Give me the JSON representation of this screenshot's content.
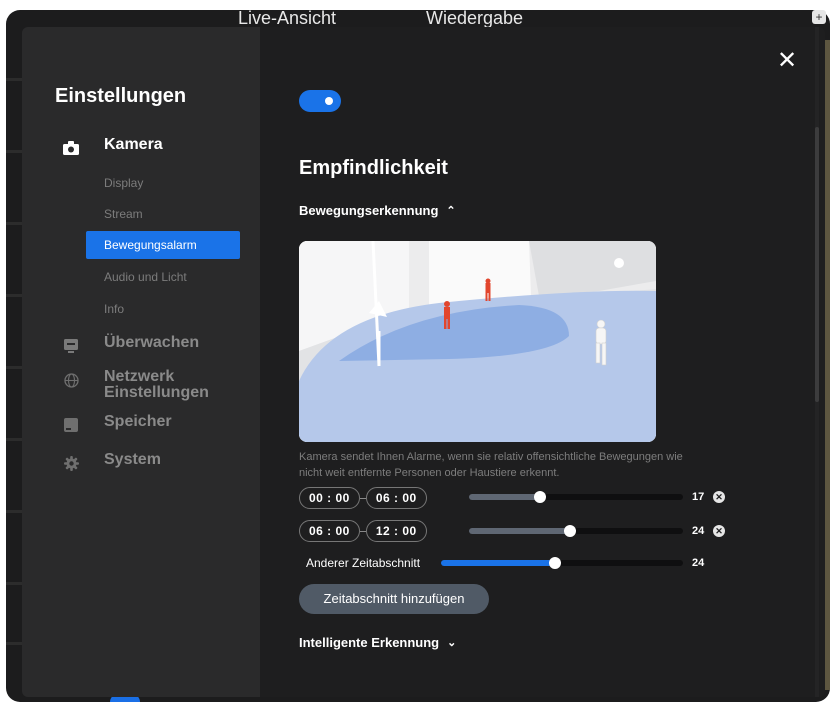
{
  "top_tabs": [
    "Live-Ansicht",
    "Wiedergabe"
  ],
  "sidebar": {
    "title": "Einstellungen",
    "items": [
      {
        "label": "Kamera",
        "icon": "camera-icon",
        "active": true
      },
      {
        "label": "Überwachen",
        "icon": "monitor-icon"
      },
      {
        "label": "Netzwerk Einstellungen",
        "icon": "globe-icon"
      },
      {
        "label": "Speicher",
        "icon": "storage-icon"
      },
      {
        "label": "System",
        "icon": "gear-icon"
      }
    ],
    "camera_subitems": [
      "Display",
      "Stream",
      "Bewegungsalarm",
      "Audio und Licht",
      "Info"
    ],
    "active_subitem": "Bewegungsalarm"
  },
  "content": {
    "close_label": "✕",
    "toggle_on": true,
    "section_title": "Empfindlichkeit",
    "motion_header": "Bewegungserkennung",
    "motion_chevron": "⌃",
    "description": "Kamera sendet Ihnen Alarme, wenn sie relativ offensichtliche Bewegungen wie nicht weit entfernte Personen oder Haustiere erkennt.",
    "schedules": [
      {
        "start": "00 : 00",
        "end": "06 : 00",
        "value": "17",
        "fraction": 0.33
      },
      {
        "start": "06 : 00",
        "end": "12 : 00",
        "value": "24",
        "fraction": 0.47
      }
    ],
    "other_period": {
      "label": "Anderer Zeitabschnitt",
      "value": "24",
      "fraction": 0.47
    },
    "add_button": "Zeitabschnitt hinzufügen",
    "smart_header": "Intelligente Erkennung",
    "smart_chevron": "⌄"
  },
  "colors": {
    "accent": "#1a73e8",
    "slider_inactive": "#5f6773",
    "dialog_bg": "#1e1e1f",
    "sidebar_bg": "#2a2a2b"
  }
}
